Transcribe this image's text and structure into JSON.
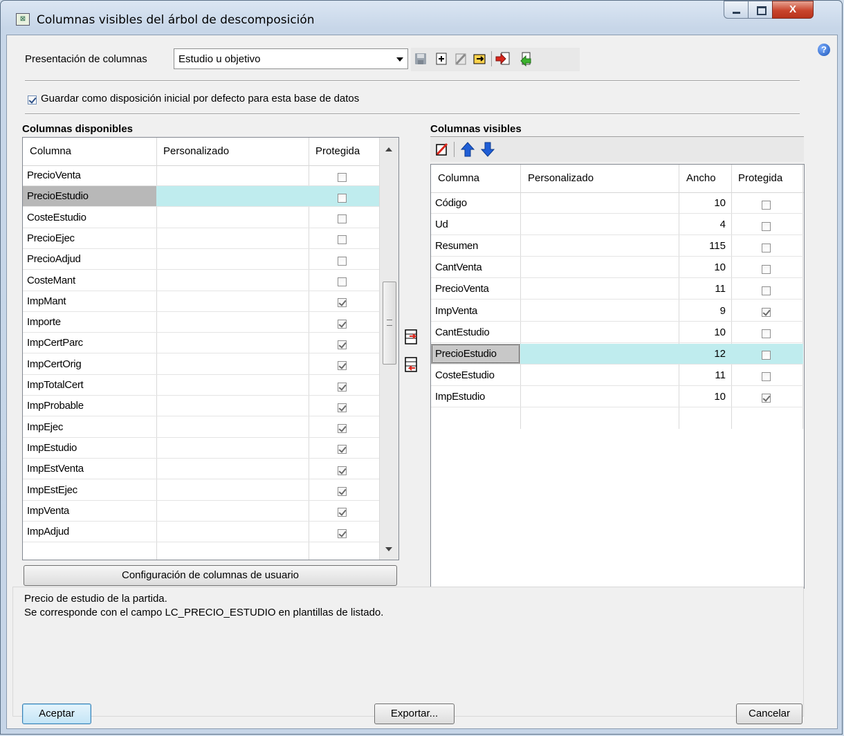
{
  "window": {
    "title": "Columnas visibles del árbol de descomposición",
    "close_glyph": "X"
  },
  "toolbar": {
    "presentacion_label": "Presentación de columnas",
    "presentacion_value": "Estudio u objetivo",
    "icons": [
      "save-icon",
      "new-icon",
      "delete-icon",
      "rename-icon",
      "import-icon",
      "export-icon"
    ]
  },
  "guardar": {
    "label": "Guardar como disposición inicial por defecto para esta base de datos",
    "checked": true
  },
  "disponibles": {
    "title": "Columnas disponibles",
    "headers": {
      "col": "Columna",
      "pers": "Personalizado",
      "prot": "Protegida"
    },
    "rows": [
      {
        "name": "PrecioVenta",
        "prot": false
      },
      {
        "name": "PrecioEstudio",
        "prot": false,
        "selected": true
      },
      {
        "name": "CosteEstudio",
        "prot": false
      },
      {
        "name": "PrecioEjec",
        "prot": false
      },
      {
        "name": "PrecioAdjud",
        "prot": false
      },
      {
        "name": "CosteMant",
        "prot": false
      },
      {
        "name": "ImpMant",
        "prot": true
      },
      {
        "name": "Importe",
        "prot": true
      },
      {
        "name": "ImpCertParc",
        "prot": true
      },
      {
        "name": "ImpCertOrig",
        "prot": true
      },
      {
        "name": "ImpTotalCert",
        "prot": true
      },
      {
        "name": "ImpProbable",
        "prot": true
      },
      {
        "name": "ImpEjec",
        "prot": true
      },
      {
        "name": "ImpEstudio",
        "prot": true
      },
      {
        "name": "ImpEstVenta",
        "prot": true
      },
      {
        "name": "ImpEstEjec",
        "prot": true
      },
      {
        "name": "ImpVenta",
        "prot": true
      },
      {
        "name": "ImpAdjud",
        "prot": true
      }
    ],
    "config_button": "Configuración de columnas de usuario"
  },
  "visibles": {
    "title": "Columnas visibles",
    "headers": {
      "col": "Columna",
      "pers": "Personalizado",
      "ancho": "Ancho",
      "prot": "Protegida"
    },
    "rows": [
      {
        "name": "Código",
        "ancho": "10",
        "prot": false
      },
      {
        "name": "Ud",
        "ancho": "4",
        "prot": false
      },
      {
        "name": "Resumen",
        "ancho": "115",
        "prot": false
      },
      {
        "name": "CantVenta",
        "ancho": "10",
        "prot": false
      },
      {
        "name": "PrecioVenta",
        "ancho": "11",
        "prot": false
      },
      {
        "name": "ImpVenta",
        "ancho": "9",
        "prot": true
      },
      {
        "name": "CantEstudio",
        "ancho": "10",
        "prot": false
      },
      {
        "name": "PrecioEstudio",
        "ancho": "12",
        "prot": false,
        "selected": true
      },
      {
        "name": "CosteEstudio",
        "ancho": "11",
        "prot": false
      },
      {
        "name": "ImpEstudio",
        "ancho": "10",
        "prot": true
      }
    ]
  },
  "description": {
    "line1": "Precio de estudio de la partida.",
    "line2": "Se corresponde con el campo LC_PRECIO_ESTUDIO en plantillas de listado."
  },
  "buttons": {
    "aceptar": "Aceptar",
    "exportar": "Exportar...",
    "cancelar": "Cancelar"
  },
  "colors": {
    "selection": "#bfecee",
    "accent": "#1a54b8"
  }
}
